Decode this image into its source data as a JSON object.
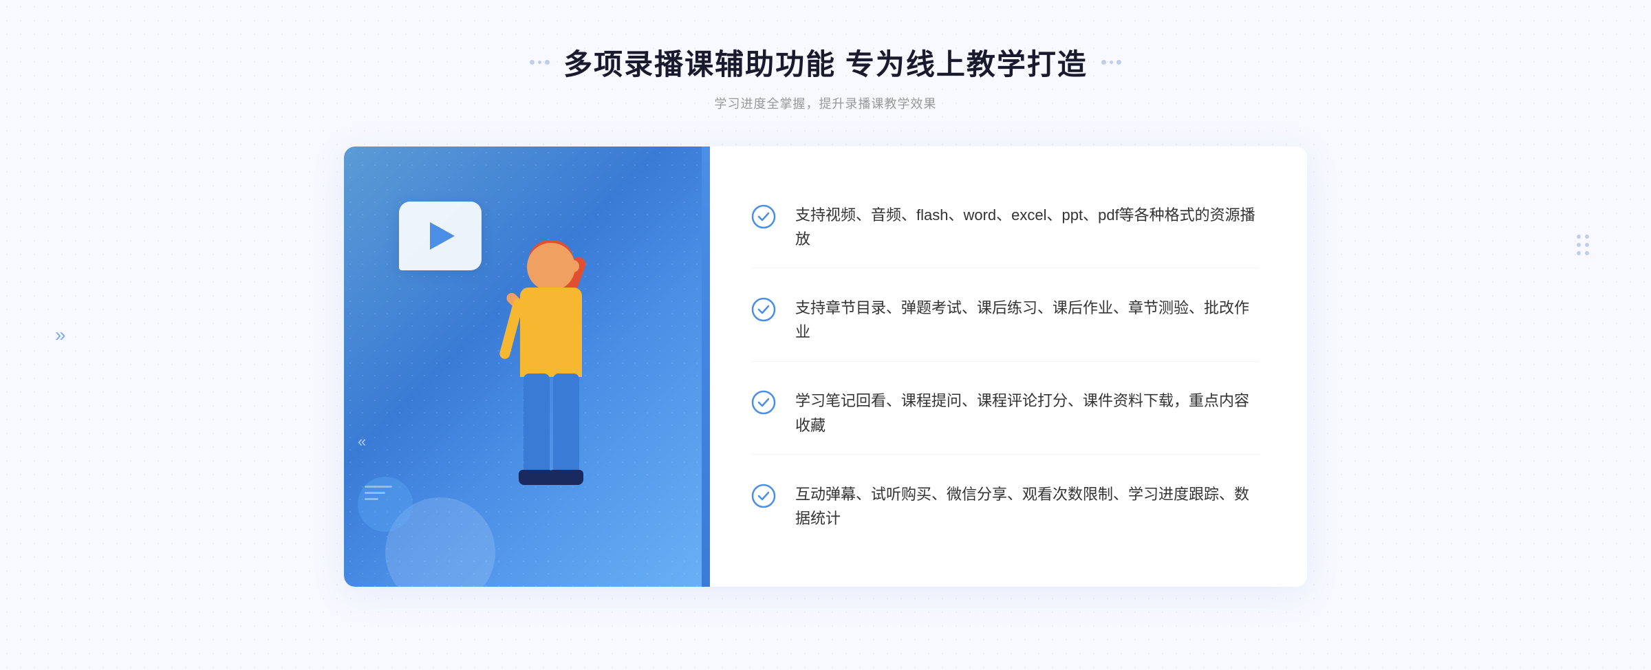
{
  "header": {
    "title": "多项录播课辅助功能 专为线上教学打造",
    "subtitle": "学习进度全掌握，提升录播课教学效果",
    "title_dots_left": "decorative",
    "title_dots_right": "decorative"
  },
  "features": [
    {
      "id": 1,
      "text": "支持视频、音频、flash、word、excel、ppt、pdf等各种格式的资源播放"
    },
    {
      "id": 2,
      "text": "支持章节目录、弹题考试、课后练习、课后作业、章节测验、批改作业"
    },
    {
      "id": 3,
      "text": "学习笔记回看、课程提问、课程评论打分、课件资料下载，重点内容收藏"
    },
    {
      "id": 4,
      "text": "互动弹幕、试听购买、微信分享、观看次数限制、学习进度跟踪、数据统计"
    }
  ],
  "colors": {
    "accent": "#4a8ee6",
    "title": "#1a1a2e",
    "subtitle": "#999999",
    "feature_text": "#333333",
    "check_color": "#4a8ee6",
    "gradient_start": "#5b9bd5",
    "gradient_end": "#6ab0f5"
  },
  "icons": {
    "play": "▶",
    "check": "circle-check",
    "left_chevrons": "«",
    "right_dots": "decorative"
  }
}
